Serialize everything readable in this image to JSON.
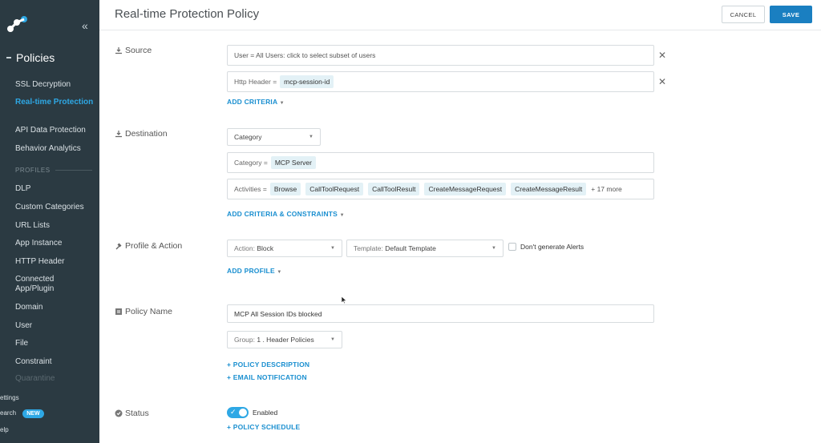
{
  "sidebar": {
    "title": "Policies",
    "items": [
      {
        "label": "SSL Decryption"
      },
      {
        "label": "Real-time Protection"
      },
      {
        "label": "API Data Protection"
      },
      {
        "label": "Behavior Analytics"
      }
    ],
    "profiles_heading": "PROFILES",
    "profiles": [
      {
        "label": "DLP"
      },
      {
        "label": "Custom Categories"
      },
      {
        "label": "URL Lists"
      },
      {
        "label": "App Instance"
      },
      {
        "label": "HTTP Header"
      },
      {
        "label": "Connected App/Plugin"
      },
      {
        "label": "Domain"
      },
      {
        "label": "User"
      },
      {
        "label": "File"
      },
      {
        "label": "Constraint"
      },
      {
        "label": "Quarantine"
      }
    ],
    "bottom": {
      "settings": "ettings",
      "search": "earch",
      "new_badge": "NEW",
      "help": "elp"
    },
    "accent": "#2ea8e5"
  },
  "header": {
    "title": "Real-time Protection Policy",
    "cancel_label": "CANCEL",
    "save_label": "SAVE"
  },
  "source": {
    "label": "Source",
    "users_text": "User = All Users: click to select subset of users",
    "http_header_field": "Http Header =",
    "http_header_value": "mcp-session-id",
    "add_criteria": "ADD CRITERIA"
  },
  "destination": {
    "label": "Destination",
    "category_select": "Category",
    "category_field": "Category =",
    "category_value": "MCP Server",
    "activities_field": "Activities =",
    "activities": [
      "Browse",
      "CallToolRequest",
      "CallToolResult",
      "CreateMessageRequest",
      "CreateMessageResult"
    ],
    "activities_more": "+ 17 more",
    "add_criteria": "ADD CRITERIA & CONSTRAINTS"
  },
  "profile_action": {
    "label": "Profile & Action",
    "action_prefix": "Action:",
    "action_value": "Block",
    "template_prefix": "Template:",
    "template_value": "Default Template",
    "dont_generate_alerts": "Don't generate Alerts",
    "add_profile": "ADD PROFILE"
  },
  "policy_name": {
    "label": "Policy Name",
    "value": "MCP All Session IDs blocked",
    "group_prefix": "Group:",
    "group_value": "1 . Header Policies",
    "policy_description": "+ POLICY DESCRIPTION",
    "email_notification": "+ EMAIL NOTIFICATION"
  },
  "status": {
    "label": "Status",
    "enabled": true,
    "enabled_label": "Enabled",
    "policy_schedule": "+ POLICY SCHEDULE"
  }
}
